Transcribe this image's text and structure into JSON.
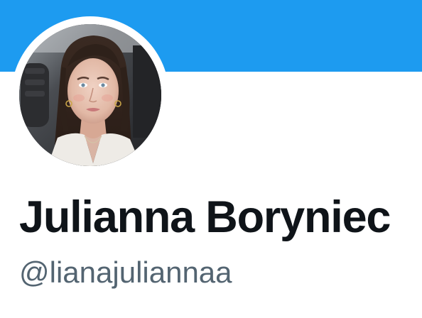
{
  "profile": {
    "display_name": "Julianna Boryniec",
    "handle": "@lianajuliannaa"
  },
  "colors": {
    "banner": "#1d9bf0",
    "name_text": "#0f1419",
    "handle_text": "#536471"
  }
}
